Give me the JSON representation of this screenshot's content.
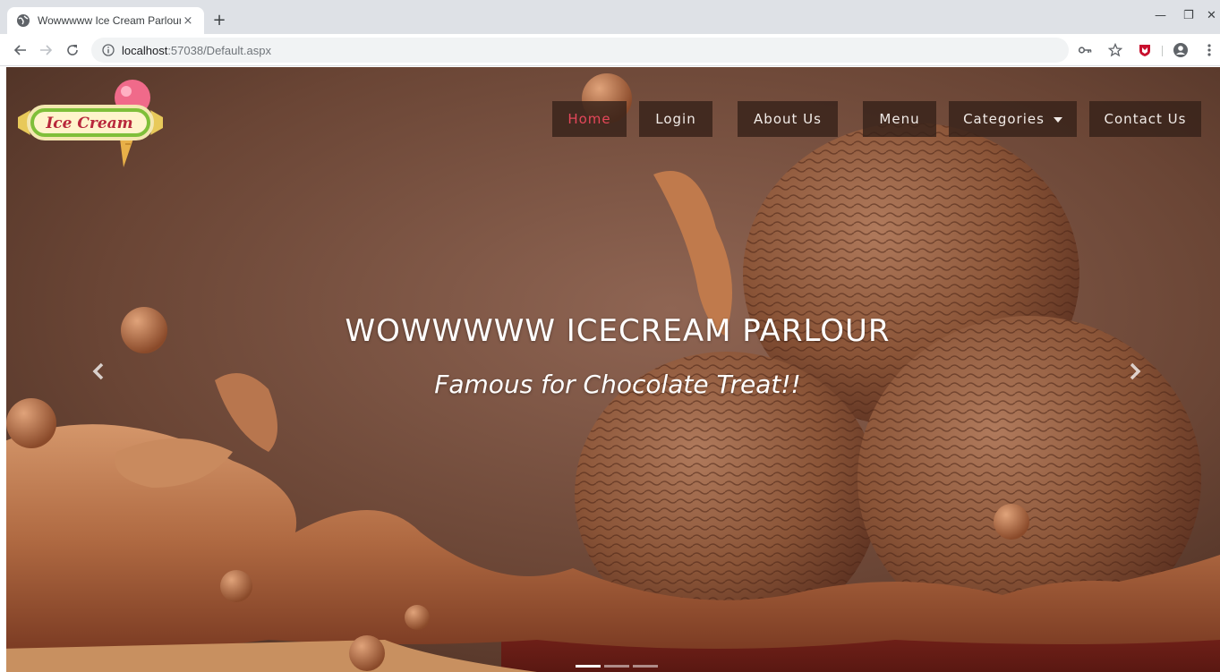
{
  "browser": {
    "tab_title": "Wowwwww Ice Cream Parlour",
    "tab_close": "×",
    "new_tab": "+",
    "url_host": "localhost",
    "url_path": ":57038/Default.aspx",
    "win_min": "—",
    "win_max": "❐",
    "win_close": "✕"
  },
  "logo": {
    "text": "Ice Cream"
  },
  "nav": {
    "items": [
      {
        "label": "Home",
        "active": true
      },
      {
        "label": "Login"
      },
      {
        "label": "About Us"
      },
      {
        "label": "Menu"
      },
      {
        "label": "Categories"
      },
      {
        "label": "Contact Us"
      }
    ]
  },
  "hero": {
    "title": "WOWWWWW ICECREAM PARLOUR",
    "subtitle": "Famous for Chocolate Treat!!",
    "slides": 3,
    "active_slide": 1
  },
  "colors": {
    "nav_bg": "#37221a",
    "nav_active": "#e4475a",
    "hero_bg": "#6b4330"
  }
}
